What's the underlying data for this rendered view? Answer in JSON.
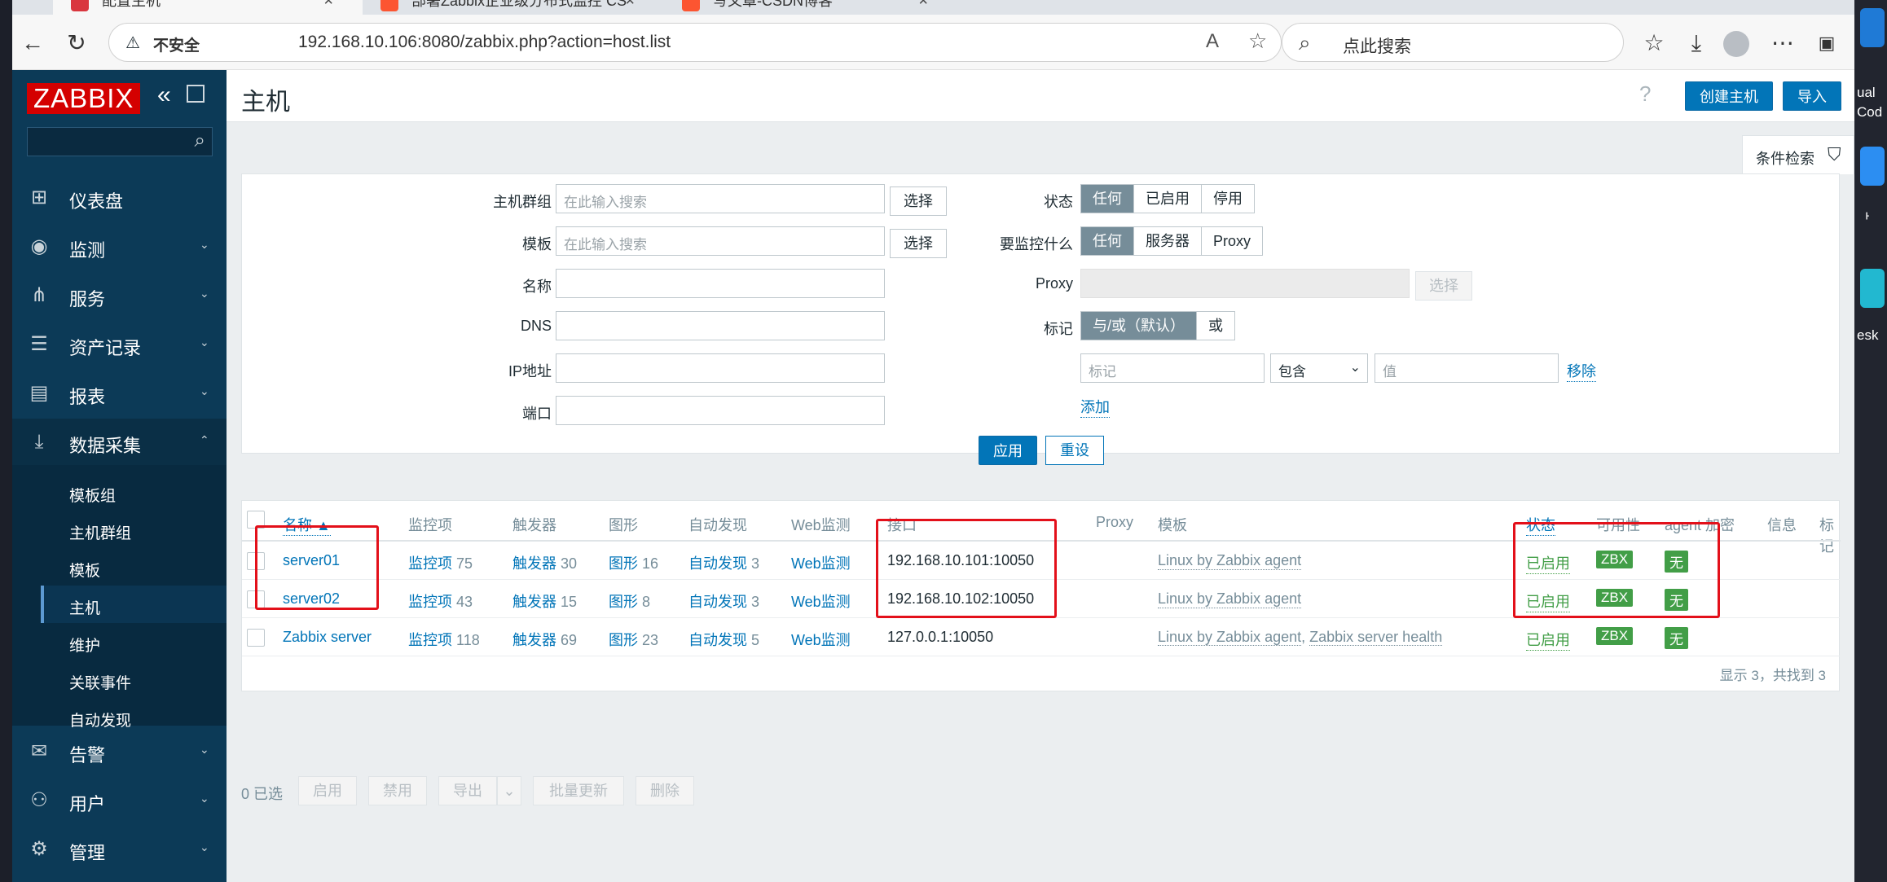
{
  "browser": {
    "tabs": [
      {
        "title": "配置主机"
      },
      {
        "title": "部署Zabbix企业级分布式监控 CS"
      },
      {
        "title": "写文章-CSDN博客"
      }
    ],
    "address": {
      "insecure_label": "不安全",
      "url": "192.168.10.106:8080/zabbix.php?action=host.list"
    },
    "search_placeholder": "点此搜索"
  },
  "desktop": {
    "right_labels": [
      "ual",
      "Cod",
      "ᅡ",
      "esk"
    ]
  },
  "sidebar": {
    "logo": "ZABBIX",
    "items": [
      {
        "label": "仪表盘",
        "icon": "dashboard-icon"
      },
      {
        "label": "监测",
        "icon": "eye-icon"
      },
      {
        "label": "服务",
        "icon": "services-icon"
      },
      {
        "label": "资产记录",
        "icon": "list-icon"
      },
      {
        "label": "报表",
        "icon": "report-icon"
      },
      {
        "label": "数据采集",
        "icon": "download-icon"
      },
      {
        "label": "告警",
        "icon": "mail-icon"
      },
      {
        "label": "用户",
        "icon": "users-icon"
      },
      {
        "label": "管理",
        "icon": "gear-icon"
      }
    ],
    "submenu": [
      "模板组",
      "主机群组",
      "模板",
      "主机",
      "维护",
      "关联事件",
      "自动发现"
    ]
  },
  "header": {
    "title": "主机",
    "help": "?",
    "create_button": "创建主机",
    "import_button": "导入"
  },
  "filter": {
    "tab_label": "条件检索",
    "host_group_label": "主机群组",
    "template_label": "模板",
    "name_label": "名称",
    "dns_label": "DNS",
    "ip_label": "IP地址",
    "port_label": "端口",
    "search_placeholder": "在此输入搜索",
    "select_button": "选择",
    "status_label": "状态",
    "status_options": [
      "任何",
      "已启用",
      "停用"
    ],
    "monitored_by_label": "要监控什么",
    "monitored_by_options": [
      "任何",
      "服务器",
      "Proxy"
    ],
    "proxy_label": "Proxy",
    "tags_label": "标记",
    "tags_options": [
      "与/或（默认）",
      "或"
    ],
    "tag_placeholder": "标记",
    "tag_operator": "包含",
    "value_placeholder": "值",
    "remove_link": "移除",
    "add_link": "添加",
    "apply_button": "应用",
    "reset_button": "重设"
  },
  "table": {
    "headers": [
      "名称 ▲",
      "监控项",
      "触发器",
      "图形",
      "自动发现",
      "Web监测",
      "接口",
      "Proxy",
      "模板",
      "状态",
      "可用性",
      "agent 加密",
      "信息",
      "标记"
    ],
    "rows": [
      {
        "name": "server01",
        "items": "监控项",
        "items_count": "75",
        "triggers": "触发器",
        "triggers_count": "30",
        "graphs": "图形",
        "graphs_count": "16",
        "discovery": "自动发现",
        "discovery_count": "3",
        "web": "Web监测",
        "interface": "192.168.10.101:10050",
        "templates": "Linux by Zabbix agent",
        "status": "已启用",
        "availability": "ZBX",
        "encryption": "无"
      },
      {
        "name": "server02",
        "items": "监控项",
        "items_count": "43",
        "triggers": "触发器",
        "triggers_count": "15",
        "graphs": "图形",
        "graphs_count": "8",
        "discovery": "自动发现",
        "discovery_count": "3",
        "web": "Web监测",
        "interface": "192.168.10.102:10050",
        "templates": "Linux by Zabbix agent",
        "status": "已启用",
        "availability": "ZBX",
        "encryption": "无"
      },
      {
        "name": "Zabbix server",
        "items": "监控项",
        "items_count": "118",
        "triggers": "触发器",
        "triggers_count": "69",
        "graphs": "图形",
        "graphs_count": "23",
        "discovery": "自动发现",
        "discovery_count": "5",
        "web": "Web监测",
        "interface": "127.0.0.1:10050",
        "templates": "Linux by Zabbix agent",
        "templates_extra": "Zabbix server health",
        "status": "已启用",
        "availability": "ZBX",
        "encryption": "无"
      }
    ],
    "footer": "显示 3，共找到 3"
  },
  "actions": {
    "selected": "0 已选",
    "buttons": [
      "启用",
      "禁用",
      "导出",
      "批量更新",
      "删除"
    ]
  },
  "colors": {
    "sidebar_bg": "#0c3a57",
    "accent": "#0275b8",
    "green": "#429e47",
    "annotation_red": "#e3101a",
    "logo_red": "#d40000"
  }
}
